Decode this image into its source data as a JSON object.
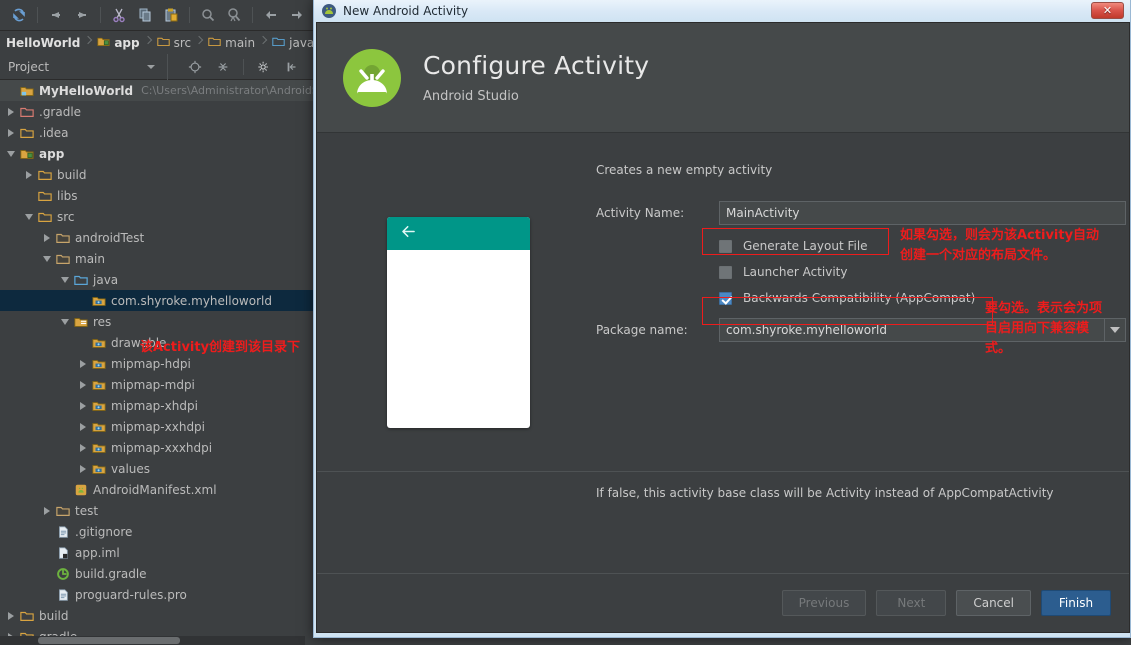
{
  "ide": {
    "toolbar": {
      "icons": [
        "sync-icon",
        "undo-icon",
        "redo-icon",
        "cut-icon",
        "copy-icon",
        "paste-icon",
        "search-icon",
        "search-everywhere-icon",
        "back-nav-icon",
        "forward-nav-icon",
        "run-icon"
      ]
    },
    "breadcrumb": {
      "items": [
        {
          "label": "HelloWorld",
          "icon": "",
          "bold": true
        },
        {
          "label": "app",
          "icon": "module-folder-icon",
          "bold": true
        },
        {
          "label": "src",
          "icon": "folder-icon",
          "bold": false
        },
        {
          "label": "main",
          "icon": "folder-icon",
          "bold": false
        },
        {
          "label": "java",
          "icon": "source-folder-icon",
          "bold": false
        }
      ]
    },
    "panel": {
      "title": "Project",
      "tools": [
        "locate-icon",
        "collapse-all-icon",
        "settings-icon",
        "hide-icon"
      ]
    },
    "tree": {
      "annotation": "该Activity创建到该目录下",
      "rows": [
        {
          "label": "MyHelloWorld",
          "path": "C:\\Users\\Administrator\\AndroidS",
          "indent": 0,
          "twist": "none",
          "icon": "project-icon",
          "bold": true,
          "state": "hl"
        },
        {
          "label": ".gradle",
          "path": "",
          "indent": 0,
          "twist": "closed",
          "icon": "folder-red-icon",
          "bold": false,
          "state": ""
        },
        {
          "label": ".idea",
          "path": "",
          "indent": 0,
          "twist": "closed",
          "icon": "folder-icon",
          "bold": false,
          "state": ""
        },
        {
          "label": "app",
          "path": "",
          "indent": 0,
          "twist": "open",
          "icon": "module-folder-icon",
          "bold": true,
          "state": ""
        },
        {
          "label": "build",
          "path": "",
          "indent": 1,
          "twist": "closed",
          "icon": "folder-icon",
          "bold": false,
          "state": ""
        },
        {
          "label": "libs",
          "path": "",
          "indent": 1,
          "twist": "none",
          "icon": "folder-icon",
          "bold": false,
          "state": ""
        },
        {
          "label": "src",
          "path": "",
          "indent": 1,
          "twist": "open",
          "icon": "folder-icon",
          "bold": false,
          "state": ""
        },
        {
          "label": "androidTest",
          "path": "",
          "indent": 2,
          "twist": "closed",
          "icon": "folder-tan-icon",
          "bold": false,
          "state": ""
        },
        {
          "label": "main",
          "path": "",
          "indent": 2,
          "twist": "open",
          "icon": "folder-tan-icon",
          "bold": false,
          "state": ""
        },
        {
          "label": "java",
          "path": "",
          "indent": 3,
          "twist": "open",
          "icon": "source-folder-icon",
          "bold": false,
          "state": ""
        },
        {
          "label": "com.shyroke.myhelloworld",
          "path": "",
          "indent": 4,
          "twist": "none",
          "icon": "package-icon",
          "bold": false,
          "state": "sel"
        },
        {
          "label": "res",
          "path": "",
          "indent": 3,
          "twist": "open",
          "icon": "res-folder-icon",
          "bold": false,
          "state": ""
        },
        {
          "label": "drawable",
          "path": "",
          "indent": 4,
          "twist": "none",
          "icon": "res-item-icon",
          "bold": false,
          "state": ""
        },
        {
          "label": "mipmap-hdpi",
          "path": "",
          "indent": 4,
          "twist": "closed",
          "icon": "res-item-icon",
          "bold": false,
          "state": ""
        },
        {
          "label": "mipmap-mdpi",
          "path": "",
          "indent": 4,
          "twist": "closed",
          "icon": "res-item-icon",
          "bold": false,
          "state": ""
        },
        {
          "label": "mipmap-xhdpi",
          "path": "",
          "indent": 4,
          "twist": "closed",
          "icon": "res-item-icon",
          "bold": false,
          "state": ""
        },
        {
          "label": "mipmap-xxhdpi",
          "path": "",
          "indent": 4,
          "twist": "closed",
          "icon": "res-item-icon",
          "bold": false,
          "state": ""
        },
        {
          "label": "mipmap-xxxhdpi",
          "path": "",
          "indent": 4,
          "twist": "closed",
          "icon": "res-item-icon",
          "bold": false,
          "state": ""
        },
        {
          "label": "values",
          "path": "",
          "indent": 4,
          "twist": "closed",
          "icon": "res-item-icon",
          "bold": false,
          "state": ""
        },
        {
          "label": "AndroidManifest.xml",
          "path": "",
          "indent": 3,
          "twist": "none",
          "icon": "manifest-icon",
          "bold": false,
          "state": ""
        },
        {
          "label": "test",
          "path": "",
          "indent": 2,
          "twist": "closed",
          "icon": "folder-tan-icon",
          "bold": false,
          "state": ""
        },
        {
          "label": ".gitignore",
          "path": "",
          "indent": 2,
          "twist": "none",
          "icon": "file-icon",
          "bold": false,
          "state": ""
        },
        {
          "label": "app.iml",
          "path": "",
          "indent": 2,
          "twist": "none",
          "icon": "iml-file-icon",
          "bold": false,
          "state": ""
        },
        {
          "label": "build.gradle",
          "path": "",
          "indent": 2,
          "twist": "none",
          "icon": "gradle-file-icon",
          "bold": false,
          "state": ""
        },
        {
          "label": "proguard-rules.pro",
          "path": "",
          "indent": 2,
          "twist": "none",
          "icon": "file-icon",
          "bold": false,
          "state": ""
        },
        {
          "label": "build",
          "path": "",
          "indent": 0,
          "twist": "closed",
          "icon": "folder-icon",
          "bold": false,
          "state": ""
        },
        {
          "label": "gradle",
          "path": "",
          "indent": 0,
          "twist": "closed",
          "icon": "folder-icon",
          "bold": false,
          "state": ""
        }
      ]
    }
  },
  "dialog": {
    "window_title": "New Android Activity",
    "close_label": "✕",
    "heading": "Configure Activity",
    "subheading": "Android Studio",
    "description": "Creates a new empty activity",
    "fields": {
      "activity_name_label": "Activity Name:",
      "activity_name_value": "MainActivity",
      "package_name_label": "Package name:",
      "package_name_value": "com.shyroke.myhelloworld"
    },
    "checkboxes": [
      {
        "label": "Generate Layout File",
        "checked": false,
        "highlighted": true
      },
      {
        "label": "Launcher Activity",
        "checked": false,
        "highlighted": false
      },
      {
        "label": "Backwards Compatibility (AppCompat)",
        "checked": true,
        "highlighted": true
      }
    ],
    "annotations": [
      {
        "line1": "如果勾选，则会为该Activity自动",
        "line2": "创建一个对应的布局文件。"
      },
      {
        "line1": "要勾选。表示会为项",
        "line2": "目启用向下兼容模",
        "line3": "式。"
      }
    ],
    "note": "If false, this activity base class will be Activity instead of AppCompatActivity",
    "buttons": [
      {
        "label": "Previous",
        "state": "disabled"
      },
      {
        "label": "Next",
        "state": "disabled"
      },
      {
        "label": "Cancel",
        "state": "normal",
        "mnemonic": "C"
      },
      {
        "label": "Finish",
        "state": "primary",
        "mnemonic": "F"
      }
    ]
  },
  "colors": {
    "ide_bg": "#3c3f41",
    "dialog_head": "#45494a",
    "selection": "#0d293e",
    "annotation_red": "#ee1c1c",
    "android_green": "#a4c639",
    "preview_teal": "#009688",
    "primary_button": "#2c5d8f"
  }
}
